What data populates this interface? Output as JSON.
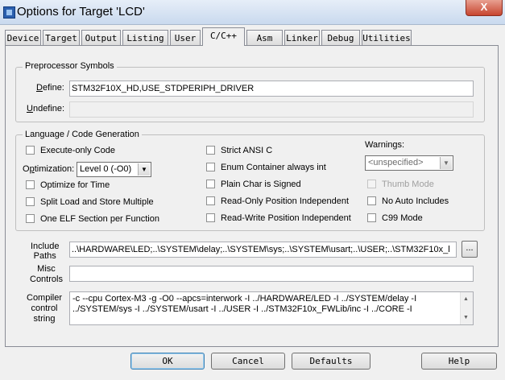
{
  "window": {
    "title": "Options for Target 'LCD'",
    "close_label": "X"
  },
  "tabs": [
    "Device",
    "Target",
    "Output",
    "Listing",
    "User",
    "C/C++",
    "Asm",
    "Linker",
    "Debug",
    "Utilities"
  ],
  "active_tab": "C/C++",
  "preprocessor": {
    "group_label": "Preprocessor Symbols",
    "define_label": "Define:",
    "define_value": "STM32F10X_HD,USE_STDPERIPH_DRIVER",
    "undefine_label": "Undefine:",
    "undefine_value": ""
  },
  "language": {
    "group_label": "Language / Code Generation",
    "execute_only": "Execute-only Code",
    "optimization_label": "Optimization:",
    "optimization_value": "Level 0 (-O0)",
    "optimize_time": "Optimize for Time",
    "split_load": "Split Load and Store Multiple",
    "one_elf": "One ELF Section per Function",
    "strict_ansi": "Strict ANSI C",
    "enum_container": "Enum Container always int",
    "plain_char": "Plain Char is Signed",
    "ropi": "Read-Only Position Independent",
    "rwpi": "Read-Write Position Independent",
    "warnings_label": "Warnings:",
    "warnings_value": "<unspecified>",
    "thumb_mode": "Thumb Mode",
    "no_auto_includes": "No Auto Includes",
    "c99_mode": "C99 Mode"
  },
  "include": {
    "label_line1": "Include",
    "label_line2": "Paths",
    "value": "..\\HARDWARE\\LED;..\\SYSTEM\\delay;..\\SYSTEM\\sys;..\\SYSTEM\\usart;..\\USER;..\\STM32F10x_l",
    "browse_label": "..."
  },
  "misc": {
    "label_line1": "Misc",
    "label_line2": "Controls",
    "value": ""
  },
  "compiler": {
    "label_line1": "Compiler",
    "label_line2": "control",
    "label_line3": "string",
    "line1": "-c --cpu Cortex-M3 -g -O0 --apcs=interwork -I ../HARDWARE/LED -I ../SYSTEM/delay -I",
    "line2": "../SYSTEM/sys -I ../SYSTEM/usart -I ../USER -I ../STM32F10x_FWLib/inc -I ../CORE -I"
  },
  "buttons": {
    "ok": "OK",
    "cancel": "Cancel",
    "defaults": "Defaults",
    "help": "Help"
  }
}
